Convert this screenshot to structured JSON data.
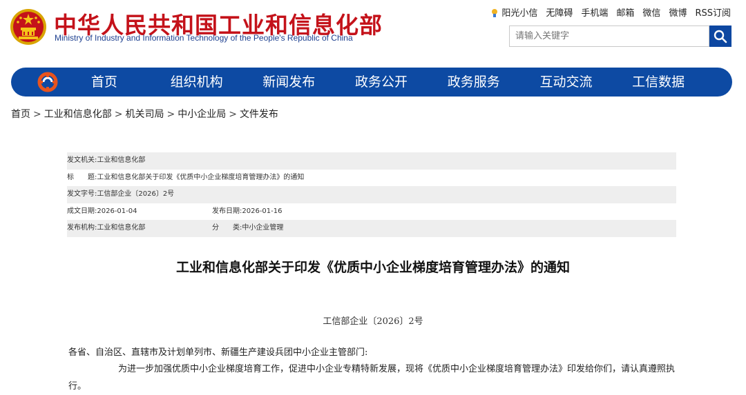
{
  "header": {
    "title_cn": "中华人民共和国工业和信息化部",
    "title_en": "Ministry of Industry and Information Technology of the People's Republic of China",
    "top_links": [
      "阳光小信",
      "无障碍",
      "手机端",
      "邮箱",
      "微信",
      "微博",
      "RSS订阅"
    ],
    "search_placeholder": "请输入关键字"
  },
  "nav": {
    "items": [
      "首页",
      "组织机构",
      "新闻发布",
      "政务公开",
      "政务服务",
      "互动交流",
      "工信数据"
    ]
  },
  "breadcrumb": [
    "首页",
    "工业和信息化部",
    "机关司局",
    "中小企业局",
    "文件发布"
  ],
  "breadcrumb_sep": ">",
  "info": {
    "issuer_label": "发文机关:",
    "issuer": "工业和信息化部",
    "title_label": "标　　题:",
    "title": "工业和信息化部关于印发《优质中小企业梯度培育管理办法》的通知",
    "doc_no_label": "发文字号:",
    "doc_no": "工信部企业〔2026〕2号",
    "date_label": "成文日期:",
    "date": "2026-01-04",
    "publish_date_label": "发布日期:",
    "publish_date": "2026-01-16",
    "publisher_label": "发布机构:",
    "publisher": "工业和信息化部",
    "category_label": "分　　类:",
    "category": "中小企业管理"
  },
  "article": {
    "title": "工业和信息化部关于印发《优质中小企业梯度培育管理办法》的通知",
    "doc_number": "工信部企业〔2026〕2号",
    "greeting": "各省、自治区、直辖市及计划单列市、新疆生产建设兵团中小企业主管部门:",
    "body": "为进一步加强优质中小企业梯度培育工作，促进中小企业专精特新发展，现将《优质中小企业梯度培育管理办法》印发给你们，请认真遵照执行。"
  },
  "colors": {
    "brand_red": "#c4121a",
    "nav_blue": "#0d4aa3",
    "en_blue": "#1d3f8f"
  }
}
